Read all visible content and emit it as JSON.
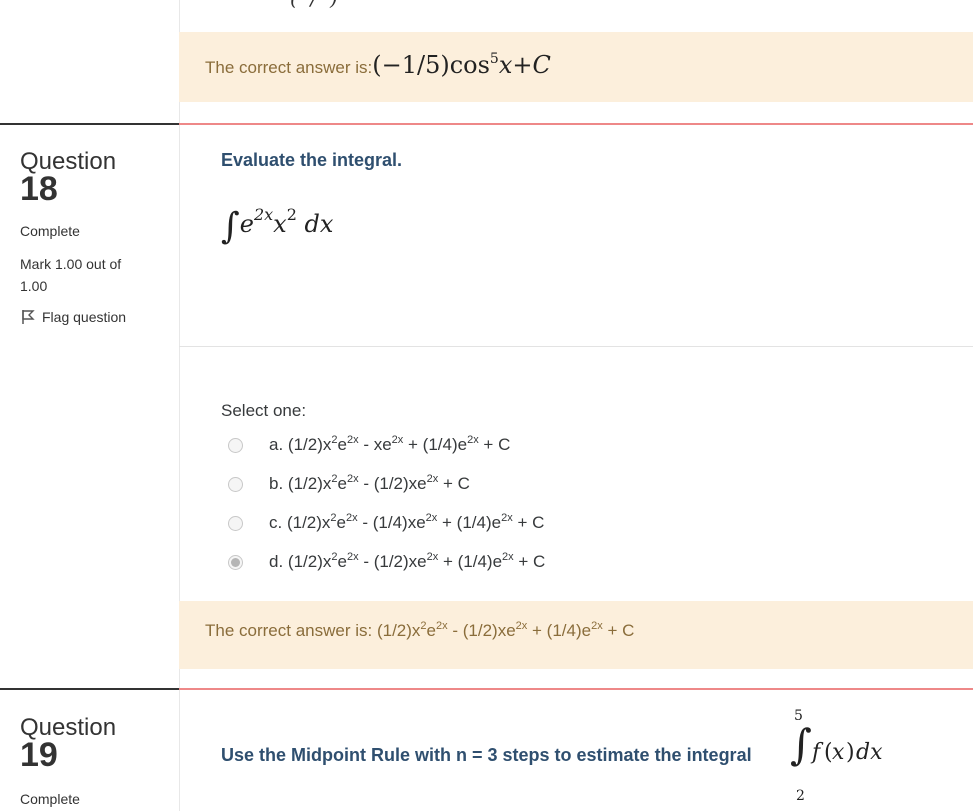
{
  "prev_feedback": {
    "prefix": "The correct answer is:",
    "answer_plain": "(−1/5)cos⁵x+C"
  },
  "q18": {
    "word": "Question",
    "number": "18",
    "status": "Complete",
    "mark_line1": "Mark 1.00 out of",
    "mark_line2": "1.00",
    "flag_label": "Flag question",
    "prompt": "Evaluate the integral.",
    "select_label": "Select one:",
    "options": [
      {
        "letter": "a.",
        "parts": [
          "(1/2)x",
          "2",
          "e",
          "2x",
          " - xe",
          "2x",
          " + (1/4)e",
          "2x",
          " + C"
        ],
        "checked": false
      },
      {
        "letter": "b.",
        "parts": [
          "(1/2)x",
          "2",
          "e",
          "2x",
          " - (1/2)xe",
          "2x",
          " + C"
        ],
        "checked": false
      },
      {
        "letter": "c.",
        "parts": [
          "(1/2)x",
          "2",
          "e",
          "2x",
          " - (1/4)xe",
          "2x",
          " + (1/4)e",
          "2x",
          " + C"
        ],
        "checked": false
      },
      {
        "letter": "d.",
        "parts": [
          "(1/2)x",
          "2",
          "e",
          "2x",
          " - (1/2)xe",
          "2x",
          " + (1/4)e",
          "2x",
          " + C"
        ],
        "checked": true
      }
    ],
    "feedback_prefix": "The correct answer is: ",
    "feedback_parts": [
      "(1/2)x",
      "2",
      "e",
      "2x",
      " - (1/2)xe",
      "2x",
      " + (1/4)e",
      "2x",
      " + C"
    ]
  },
  "q19": {
    "word": "Question",
    "number": "19",
    "status": "Complete",
    "prompt": "Use the Midpoint Rule with n = 3 steps to estimate the integral",
    "upper_limit": "5",
    "lower_limit": "2"
  },
  "colors": {
    "feedback_bg": "#fcefdc",
    "feedback_text": "#8a6d3b",
    "prompt_text": "#2f4f6f",
    "question_rule": "#e88888"
  }
}
